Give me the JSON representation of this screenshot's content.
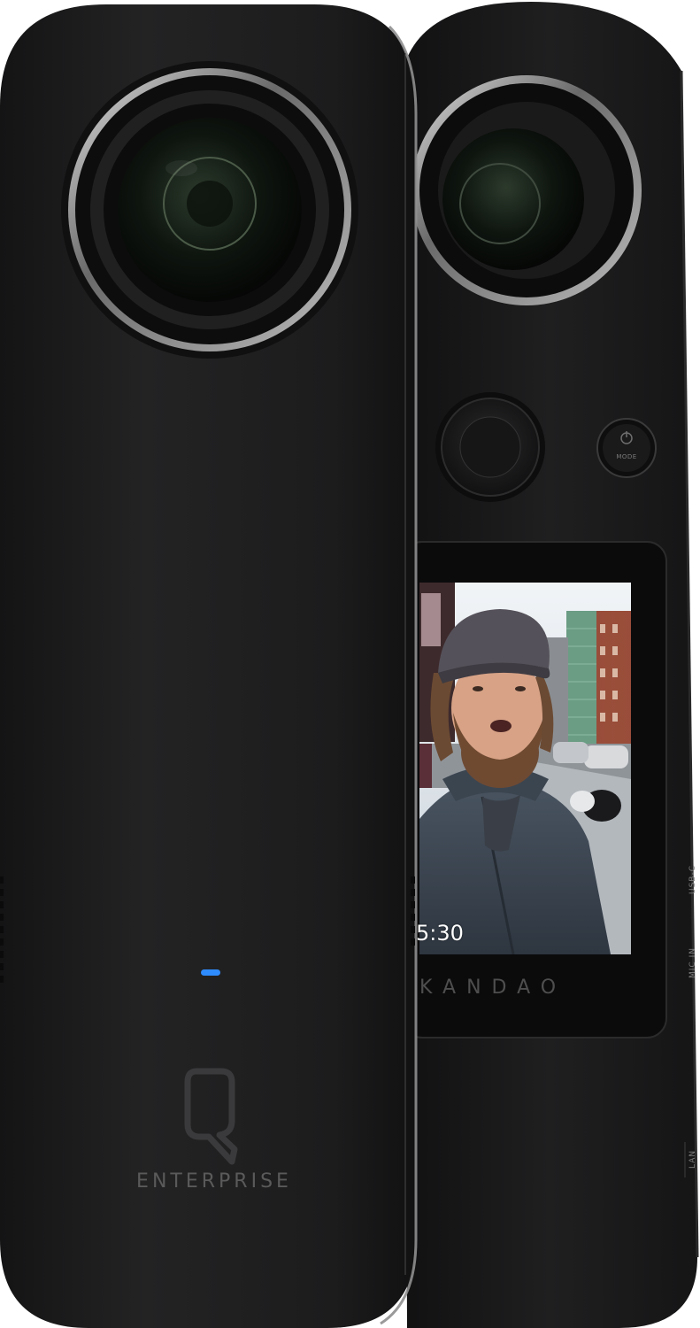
{
  "product": {
    "front_logo": "Q",
    "front_label": "ENTERPRISE",
    "screen_brand": "KANDAO",
    "screen_timer": "5:30",
    "mode_button_label": "MODE",
    "ports": {
      "usb": "USB-C",
      "mic": "MIC IN",
      "lan": "LAN"
    },
    "status_led": "on"
  },
  "colors": {
    "body": "#1d1d1e",
    "rim": "#9a9a9a",
    "led": "#2f8cff",
    "background": "#ffffff"
  }
}
